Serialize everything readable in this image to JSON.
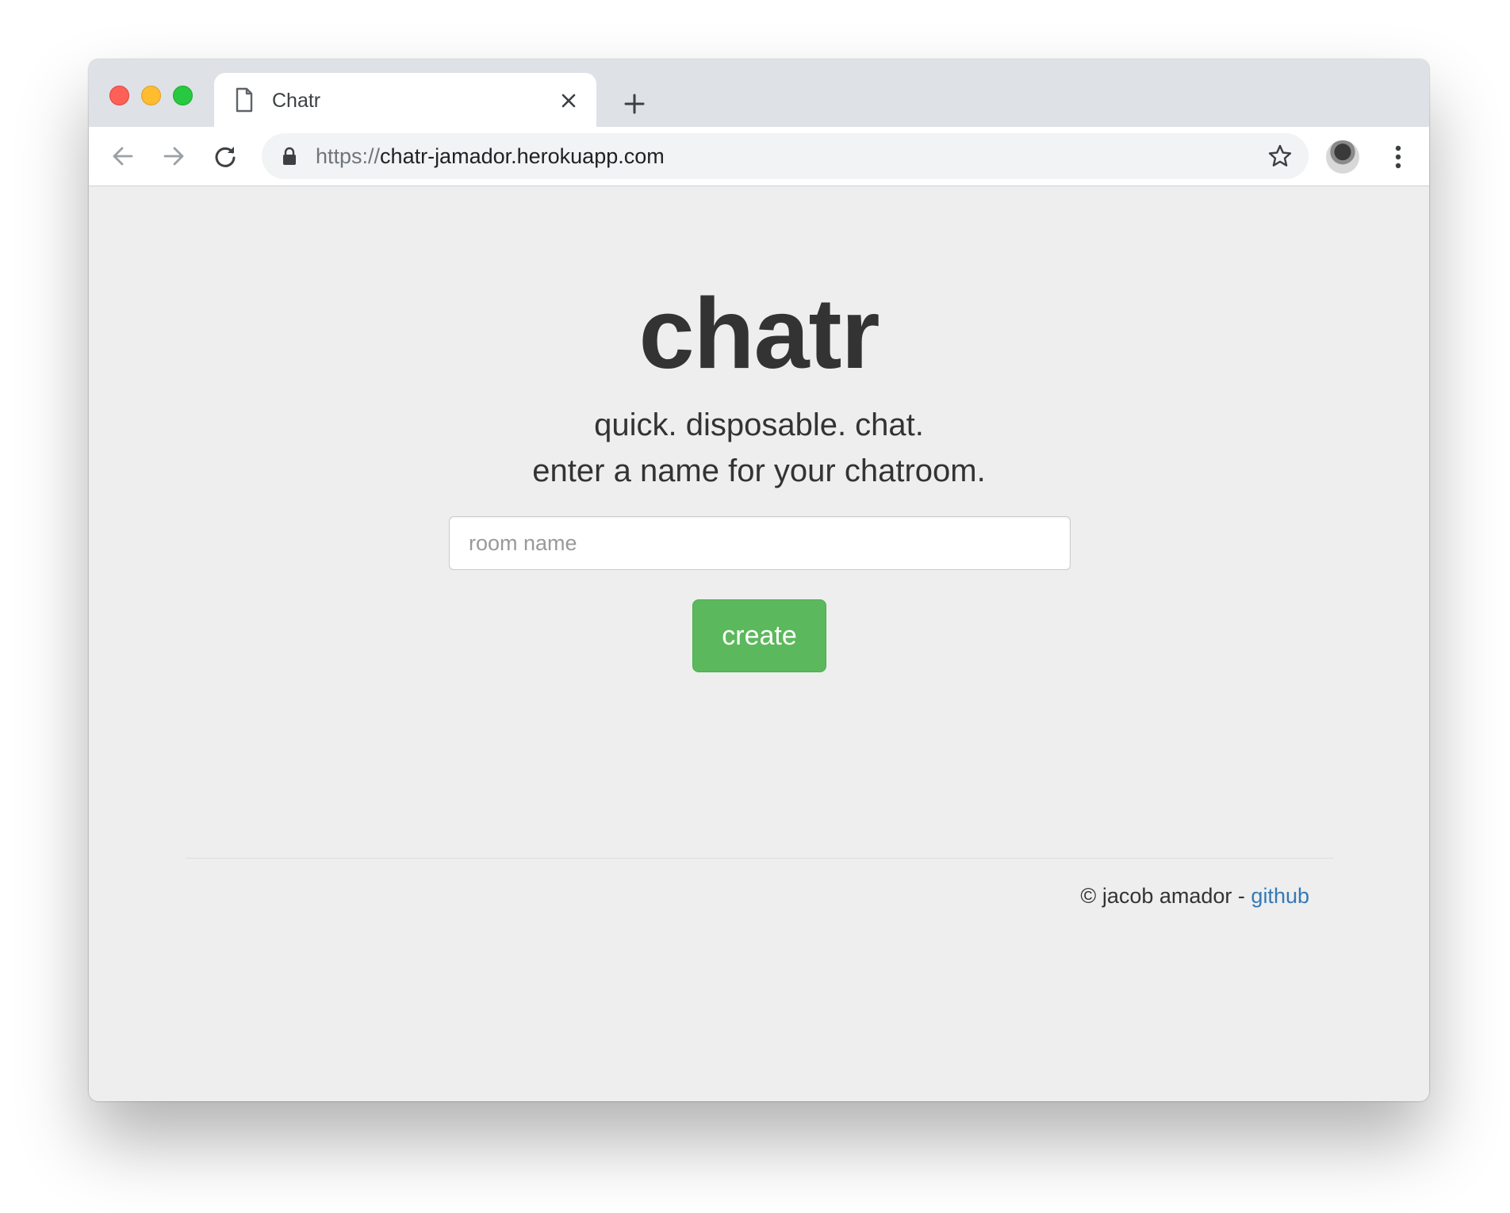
{
  "browser": {
    "tab": {
      "title": "Chatr"
    },
    "address_bar": {
      "scheme": "https://",
      "host": "chatr-jamador.herokuapp.com"
    },
    "icons": {
      "close_window": "red-traffic-light",
      "minimize_window": "yellow-traffic-light",
      "maximize_window": "green-traffic-light",
      "tab_page": "document-icon",
      "tab_close": "close-icon",
      "new_tab": "plus-icon",
      "back": "arrow-left-icon",
      "forward": "arrow-right-icon",
      "reload": "reload-icon",
      "secure": "lock-icon",
      "bookmark": "star-icon",
      "profile": "avatar",
      "menu": "kebab-menu-icon"
    }
  },
  "page": {
    "logo": "chatr",
    "tagline_1": "quick. disposable. chat.",
    "tagline_2": "enter a name for your chatroom.",
    "room_input": {
      "placeholder": "room name",
      "value": ""
    },
    "create_label": "create",
    "footer": {
      "copyright": "© jacob amador - ",
      "link_label": "github"
    }
  },
  "colors": {
    "page_background": "#eeeeee",
    "create_button": "#5cb85c",
    "link": "#337ab7",
    "text": "#333333"
  }
}
